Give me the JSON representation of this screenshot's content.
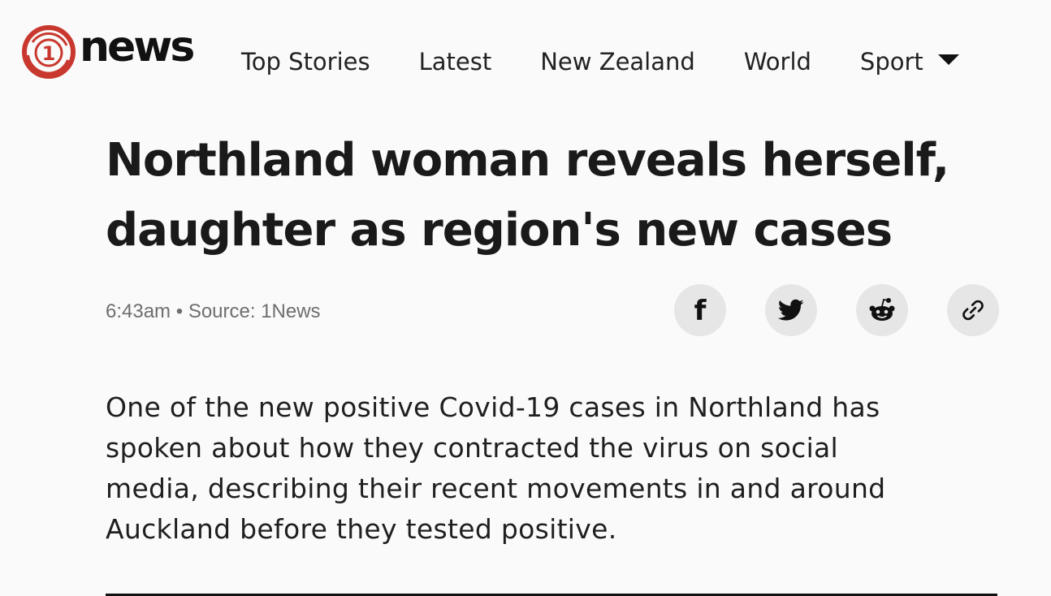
{
  "brand": {
    "name": "news",
    "logo_numeral": "1",
    "logo_color": "#c9382e"
  },
  "nav": {
    "items": [
      {
        "label": "Top Stories"
      },
      {
        "label": "Latest"
      },
      {
        "label": "New Zealand"
      },
      {
        "label": "World"
      },
      {
        "label": "Sport",
        "has_dropdown": true
      }
    ]
  },
  "article": {
    "headline_line1": "Northland woman reveals herself,",
    "headline_line2": "daughter as region's new cases",
    "time": "6:43am",
    "separator": "•",
    "source": "Source: 1News",
    "share": {
      "facebook_glyph": "f",
      "icons": [
        "facebook-icon",
        "twitter-icon",
        "reddit-icon",
        "link-icon"
      ]
    },
    "lede_line1": "One of the new positive Covid-19 cases in Northland has",
    "lede_line2": "spoken about how they contracted the virus on social",
    "lede_line3": "media, describing their recent movements in and around",
    "lede_line4": "Auckland before they tested positive."
  },
  "colors": {
    "background": "#fafafa",
    "text": "#1a1a1a",
    "meta": "#6e6e6e",
    "share_button": "#e6e6e6"
  }
}
